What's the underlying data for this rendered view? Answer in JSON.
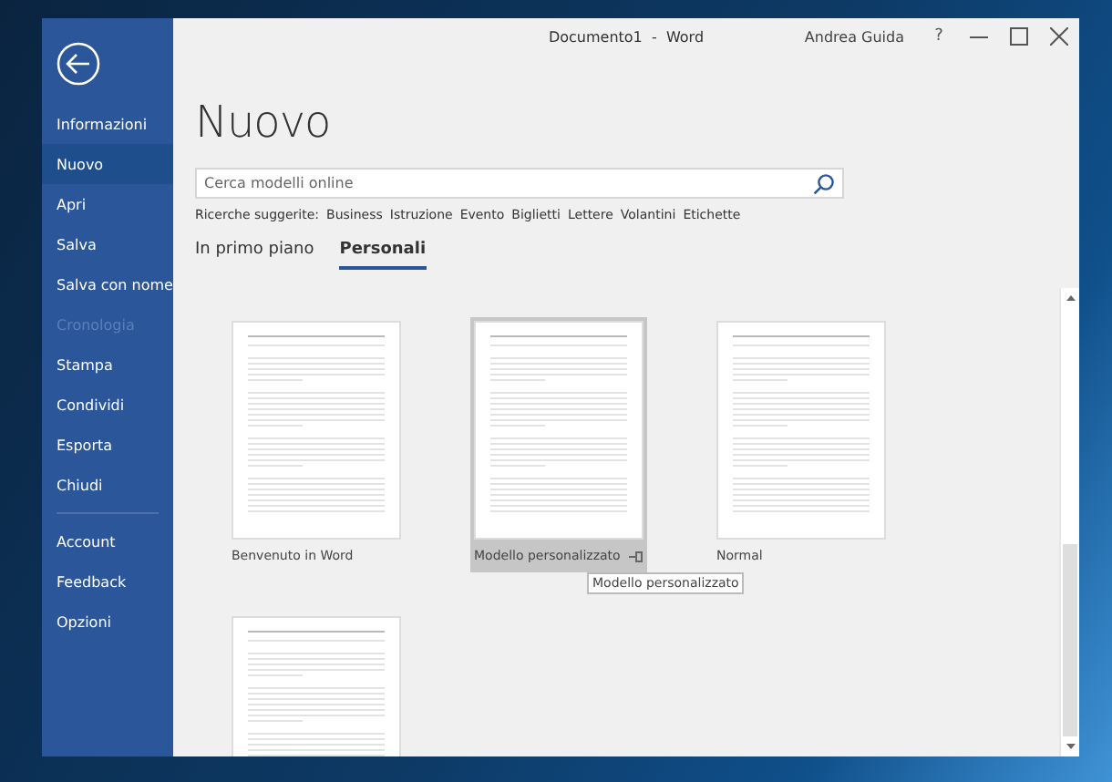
{
  "window": {
    "title": "Documento1  -  Word",
    "user": "Andrea Guida",
    "help": "?"
  },
  "sidebar": {
    "items": [
      {
        "label": "Informazioni",
        "selected": false,
        "disabled": false
      },
      {
        "label": "Nuovo",
        "selected": true,
        "disabled": false
      },
      {
        "label": "Apri",
        "selected": false,
        "disabled": false
      },
      {
        "label": "Salva",
        "selected": false,
        "disabled": false
      },
      {
        "label": "Salva con nome",
        "selected": false,
        "disabled": false
      },
      {
        "label": "Cronologia",
        "selected": false,
        "disabled": true
      },
      {
        "label": "Stampa",
        "selected": false,
        "disabled": false
      },
      {
        "label": "Condividi",
        "selected": false,
        "disabled": false
      },
      {
        "label": "Esporta",
        "selected": false,
        "disabled": false
      },
      {
        "label": "Chiudi",
        "selected": false,
        "disabled": false
      }
    ],
    "bottom_items": [
      {
        "label": "Account",
        "selected": false,
        "disabled": false
      },
      {
        "label": "Feedback",
        "selected": false,
        "disabled": false
      },
      {
        "label": "Opzioni",
        "selected": false,
        "disabled": false
      }
    ]
  },
  "heading": "Nuovo",
  "search": {
    "placeholder": "Cerca modelli online"
  },
  "suggestions": {
    "label": "Ricerche suggerite:",
    "items": [
      "Business",
      "Istruzione",
      "Evento",
      "Biglietti",
      "Lettere",
      "Volantini",
      "Etichette"
    ]
  },
  "tabs": [
    {
      "label": "In primo piano",
      "selected": false
    },
    {
      "label": "Personali",
      "selected": true
    }
  ],
  "templates": [
    {
      "name": "Benvenuto in Word",
      "selected": false
    },
    {
      "name": "Modello personalizzato",
      "selected": true,
      "tooltip": "Modello personalizzato"
    },
    {
      "name": "Normal",
      "selected": false
    },
    {
      "selected": false
    }
  ]
}
